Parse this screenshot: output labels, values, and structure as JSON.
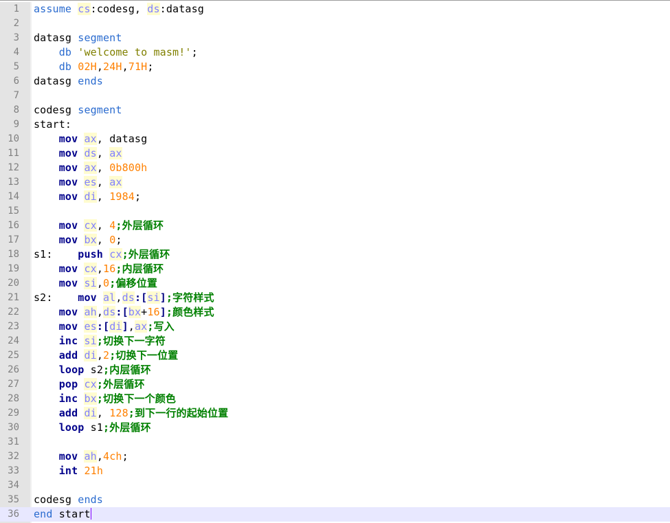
{
  "editor": {
    "current_line": 36,
    "lines": [
      [
        [
          "dir",
          "assume"
        ],
        [
          "plain",
          " "
        ],
        [
          "reg",
          "cs"
        ],
        [
          "plain",
          ":codesg, "
        ],
        [
          "reg",
          "ds"
        ],
        [
          "plain",
          ":datasg"
        ]
      ],
      [],
      [
        [
          "plain",
          "datasg "
        ],
        [
          "dir",
          "segment"
        ]
      ],
      [
        [
          "plain",
          "    "
        ],
        [
          "dir",
          "db"
        ],
        [
          "plain",
          " "
        ],
        [
          "str",
          "'welcome to masm!'"
        ],
        [
          "plain",
          ";"
        ]
      ],
      [
        [
          "plain",
          "    "
        ],
        [
          "dir",
          "db"
        ],
        [
          "plain",
          " "
        ],
        [
          "num",
          "02H"
        ],
        [
          "plain",
          ","
        ],
        [
          "num",
          "24H"
        ],
        [
          "plain",
          ","
        ],
        [
          "num",
          "71H"
        ],
        [
          "plain",
          ";"
        ]
      ],
      [
        [
          "plain",
          "datasg "
        ],
        [
          "dir",
          "ends"
        ]
      ],
      [],
      [
        [
          "plain",
          "codesg "
        ],
        [
          "dir",
          "segment"
        ]
      ],
      [
        [
          "plain",
          "start:"
        ]
      ],
      [
        [
          "plain",
          "    "
        ],
        [
          "instr",
          "mov"
        ],
        [
          "plain",
          " "
        ],
        [
          "reg",
          "ax"
        ],
        [
          "plain",
          ", datasg"
        ]
      ],
      [
        [
          "plain",
          "    "
        ],
        [
          "instr",
          "mov"
        ],
        [
          "plain",
          " "
        ],
        [
          "reg",
          "ds"
        ],
        [
          "plain",
          ", "
        ],
        [
          "reg",
          "ax"
        ]
      ],
      [
        [
          "plain",
          "    "
        ],
        [
          "instr",
          "mov"
        ],
        [
          "plain",
          " "
        ],
        [
          "reg",
          "ax"
        ],
        [
          "plain",
          ", "
        ],
        [
          "num",
          "0b800h"
        ]
      ],
      [
        [
          "plain",
          "    "
        ],
        [
          "instr",
          "mov"
        ],
        [
          "plain",
          " "
        ],
        [
          "reg",
          "es"
        ],
        [
          "plain",
          ", "
        ],
        [
          "reg",
          "ax"
        ]
      ],
      [
        [
          "plain",
          "    "
        ],
        [
          "instr",
          "mov"
        ],
        [
          "plain",
          " "
        ],
        [
          "reg",
          "di"
        ],
        [
          "plain",
          ", "
        ],
        [
          "num",
          "1984"
        ],
        [
          "plain",
          ";"
        ]
      ],
      [],
      [
        [
          "plain",
          "    "
        ],
        [
          "instr",
          "mov"
        ],
        [
          "plain",
          " "
        ],
        [
          "reg",
          "cx"
        ],
        [
          "plain",
          ", "
        ],
        [
          "num",
          "4"
        ],
        [
          "com",
          ";外层循环"
        ]
      ],
      [
        [
          "plain",
          "    "
        ],
        [
          "instr",
          "mov"
        ],
        [
          "plain",
          " "
        ],
        [
          "reg",
          "bx"
        ],
        [
          "plain",
          ", "
        ],
        [
          "num",
          "0"
        ],
        [
          "plain",
          ";"
        ]
      ],
      [
        [
          "plain",
          "s1:    "
        ],
        [
          "instr",
          "push"
        ],
        [
          "plain",
          " "
        ],
        [
          "reg",
          "cx"
        ],
        [
          "com",
          ";外层循环"
        ]
      ],
      [
        [
          "plain",
          "    "
        ],
        [
          "instr",
          "mov"
        ],
        [
          "plain",
          " "
        ],
        [
          "reg",
          "cx"
        ],
        [
          "plain",
          ","
        ],
        [
          "num",
          "16"
        ],
        [
          "com",
          ";内层循环"
        ]
      ],
      [
        [
          "plain",
          "    "
        ],
        [
          "instr",
          "mov"
        ],
        [
          "plain",
          " "
        ],
        [
          "reg",
          "si"
        ],
        [
          "plain",
          ","
        ],
        [
          "num",
          "0"
        ],
        [
          "com",
          ";偏移位置"
        ]
      ],
      [
        [
          "plain",
          "s2:    "
        ],
        [
          "instr",
          "mov"
        ],
        [
          "plain",
          " "
        ],
        [
          "reg",
          "al"
        ],
        [
          "plain",
          ","
        ],
        [
          "reg",
          "ds"
        ],
        [
          "br",
          ":["
        ],
        [
          "reg",
          "si"
        ],
        [
          "br",
          "]"
        ],
        [
          "com",
          ";字符样式"
        ]
      ],
      [
        [
          "plain",
          "    "
        ],
        [
          "instr",
          "mov"
        ],
        [
          "plain",
          " "
        ],
        [
          "reg",
          "ah"
        ],
        [
          "plain",
          ","
        ],
        [
          "reg",
          "ds"
        ],
        [
          "br",
          ":["
        ],
        [
          "reg",
          "bx"
        ],
        [
          "plain",
          "+"
        ],
        [
          "num",
          "16"
        ],
        [
          "br",
          "]"
        ],
        [
          "com",
          ";颜色样式"
        ]
      ],
      [
        [
          "plain",
          "    "
        ],
        [
          "instr",
          "mov"
        ],
        [
          "plain",
          " "
        ],
        [
          "reg",
          "es"
        ],
        [
          "br",
          ":["
        ],
        [
          "reg",
          "di"
        ],
        [
          "br",
          "]"
        ],
        [
          "plain",
          ","
        ],
        [
          "reg",
          "ax"
        ],
        [
          "com",
          ";写入"
        ]
      ],
      [
        [
          "plain",
          "    "
        ],
        [
          "instr",
          "inc"
        ],
        [
          "plain",
          " "
        ],
        [
          "reg",
          "si"
        ],
        [
          "com",
          ";切换下一字符"
        ]
      ],
      [
        [
          "plain",
          "    "
        ],
        [
          "instr",
          "add"
        ],
        [
          "plain",
          " "
        ],
        [
          "reg",
          "di"
        ],
        [
          "plain",
          ","
        ],
        [
          "num",
          "2"
        ],
        [
          "com",
          ";切换下一位置"
        ]
      ],
      [
        [
          "plain",
          "    "
        ],
        [
          "instr",
          "loop"
        ],
        [
          "plain",
          " s2"
        ],
        [
          "com",
          ";内层循环"
        ]
      ],
      [
        [
          "plain",
          "    "
        ],
        [
          "instr",
          "pop"
        ],
        [
          "plain",
          " "
        ],
        [
          "reg",
          "cx"
        ],
        [
          "com",
          ";外层循环"
        ]
      ],
      [
        [
          "plain",
          "    "
        ],
        [
          "instr",
          "inc"
        ],
        [
          "plain",
          " "
        ],
        [
          "reg",
          "bx"
        ],
        [
          "com",
          ";切换下一个颜色"
        ]
      ],
      [
        [
          "plain",
          "    "
        ],
        [
          "instr",
          "add"
        ],
        [
          "plain",
          " "
        ],
        [
          "reg",
          "di"
        ],
        [
          "plain",
          ", "
        ],
        [
          "num",
          "128"
        ],
        [
          "com",
          ";到下一行的起始位置"
        ]
      ],
      [
        [
          "plain",
          "    "
        ],
        [
          "instr",
          "loop"
        ],
        [
          "plain",
          " s1"
        ],
        [
          "com",
          ";外层循环"
        ]
      ],
      [],
      [
        [
          "plain",
          "    "
        ],
        [
          "instr",
          "mov"
        ],
        [
          "plain",
          " "
        ],
        [
          "reg",
          "ah"
        ],
        [
          "plain",
          ","
        ],
        [
          "num",
          "4ch"
        ],
        [
          "plain",
          ";"
        ]
      ],
      [
        [
          "plain",
          "    "
        ],
        [
          "instr",
          "int"
        ],
        [
          "plain",
          " "
        ],
        [
          "num",
          "21h"
        ]
      ],
      [],
      [
        [
          "plain",
          "codesg "
        ],
        [
          "dir",
          "ends"
        ]
      ],
      [
        [
          "dir",
          "end"
        ],
        [
          "plain",
          " start"
        ]
      ]
    ]
  }
}
